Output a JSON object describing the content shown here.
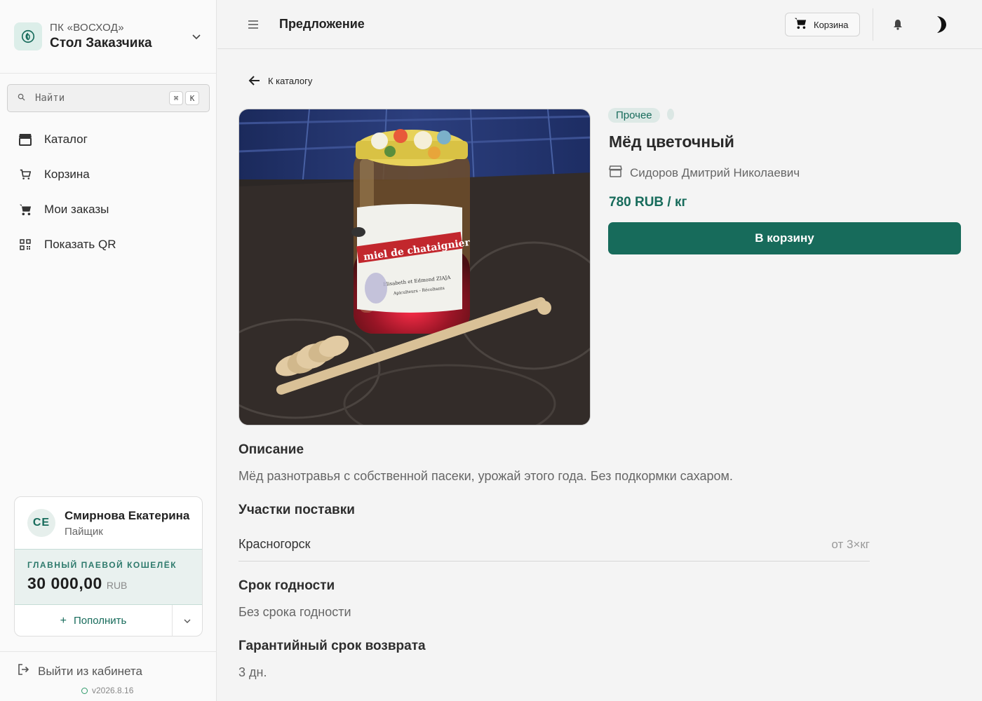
{
  "org": {
    "subtitle": "ПК «ВОСХОД»",
    "title": "Стол Заказчика"
  },
  "search": {
    "placeholder": "Найти",
    "shortcut_keys": [
      "⌘",
      "K"
    ]
  },
  "nav": [
    {
      "label": "Каталог",
      "icon": "store-icon"
    },
    {
      "label": "Корзина",
      "icon": "cart-icon"
    },
    {
      "label": "Мои заказы",
      "icon": "cart-icon"
    },
    {
      "label": "Показать QR",
      "icon": "qr-icon"
    }
  ],
  "user": {
    "initials": "СЕ",
    "name": "Смирнова Екатерина",
    "role": "Пайщик",
    "wallet_label": "ГЛАВНЫЙ ПАЕВОЙ КОШЕЛЁК",
    "wallet_amount": "30 000,00",
    "wallet_currency": "RUB",
    "topup_label": "Пополнить"
  },
  "logout_label": "Выйти из кабинета",
  "version": "v2026.8.16",
  "header": {
    "title": "Предложение",
    "cart_label": "Корзина"
  },
  "back_label": "К каталогу",
  "product": {
    "image_alt": "miel de chataignier",
    "tag": "Прочее",
    "name": "Мёд цветочный",
    "seller": "Сидоров Дмитрий Николаевич",
    "price": "780 RUB / кг",
    "add_to_cart": "В корзину"
  },
  "sections": {
    "description_title": "Описание",
    "description_text": "Мёд разнотравья с собственной пасеки, урожай этого года. Без подкормки сахаром.",
    "zones_title": "Участки поставки",
    "zones": [
      {
        "name": "Красногорск",
        "min": "от 3×кг"
      }
    ],
    "shelf_title": "Срок годности",
    "shelf_text": "Без срока годности",
    "return_title": "Гарантийный срок возврата",
    "return_text": "3 дн."
  },
  "colors": {
    "accent": "#176b5b",
    "accent_light": "#dde9e6",
    "background": "#f4f4f4"
  }
}
